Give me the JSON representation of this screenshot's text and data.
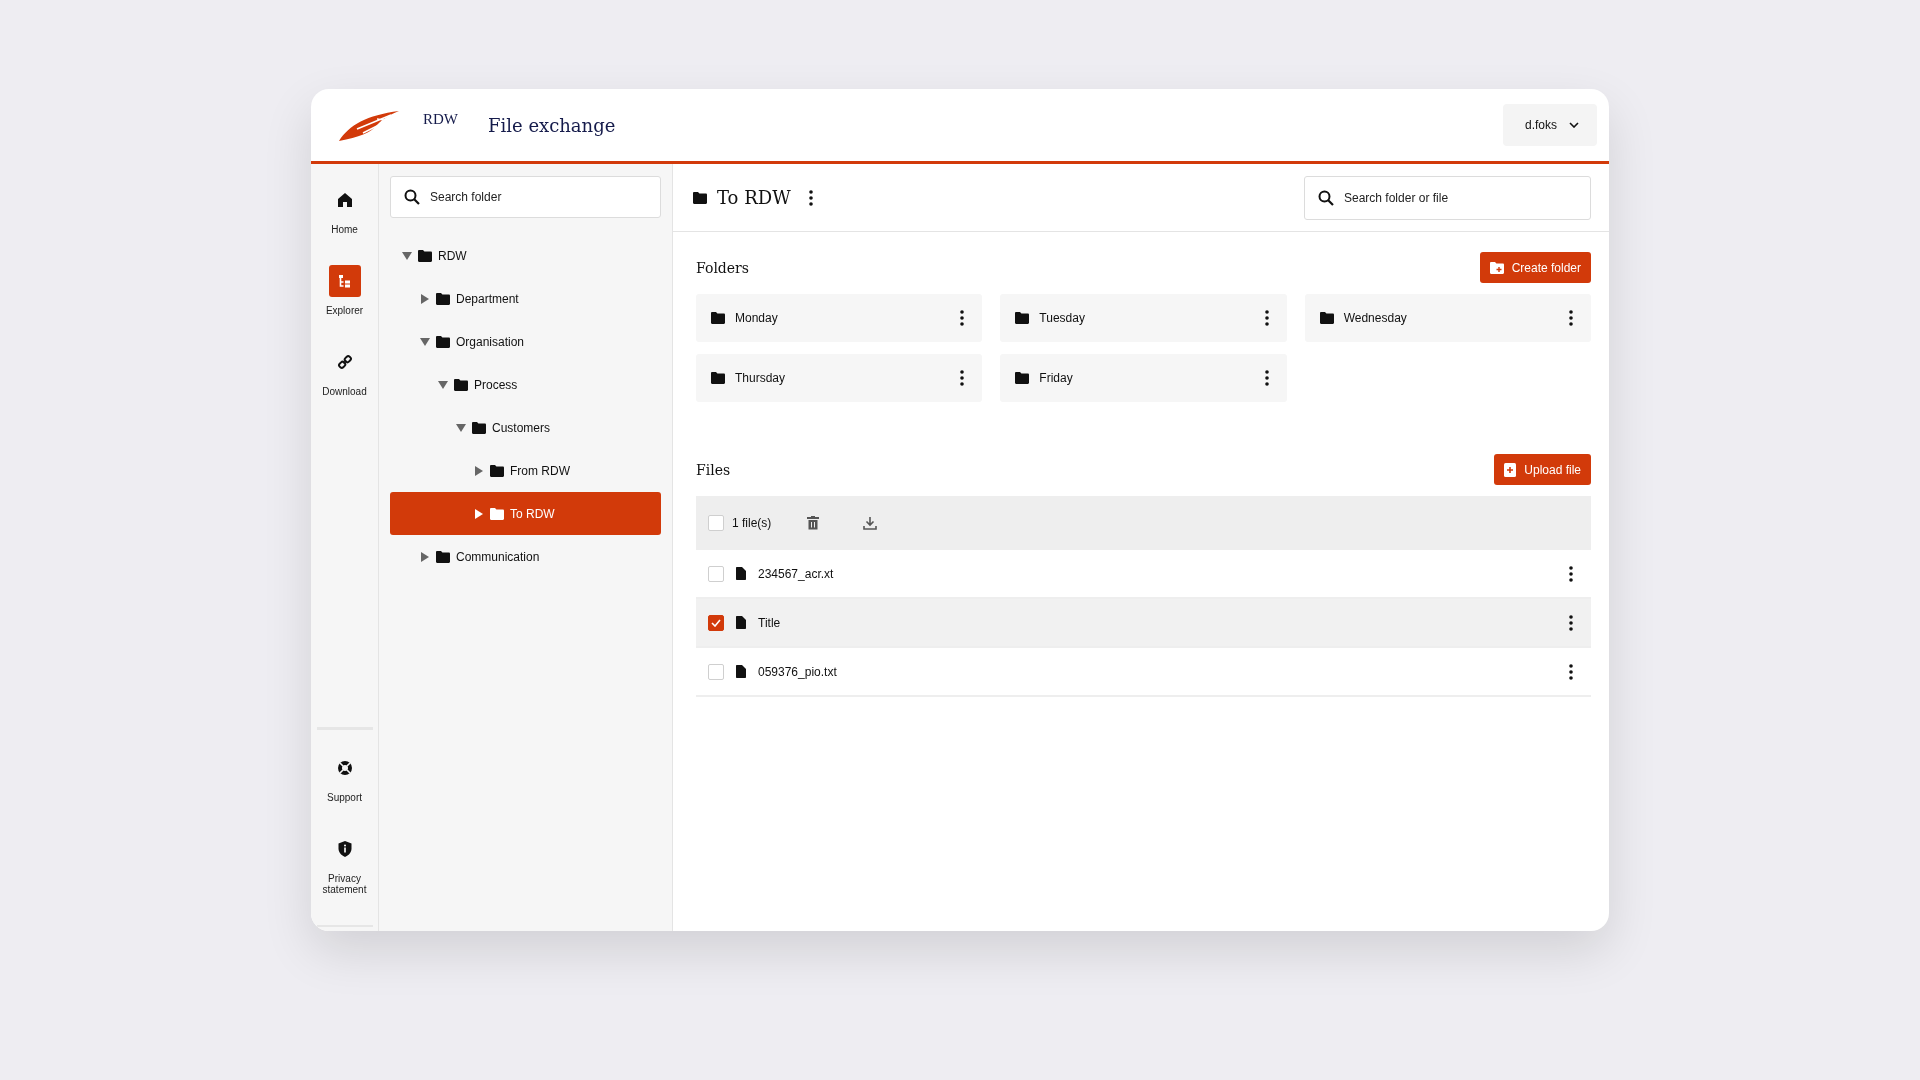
{
  "header": {
    "brand": "RDW",
    "title": "File exchange",
    "user": "d.foks"
  },
  "nav": {
    "top": [
      {
        "label": "Home",
        "kind": "home",
        "selected": false
      },
      {
        "label": "Explorer",
        "kind": "explorer",
        "selected": true
      },
      {
        "label": "Download",
        "kind": "download",
        "selected": false
      }
    ],
    "bottom": [
      {
        "label": "Support",
        "kind": "support",
        "selected": false
      },
      {
        "label": "Privacy statement",
        "kind": "privacy",
        "selected": false
      }
    ]
  },
  "tree": {
    "search": {
      "placeholder": "Search folder"
    },
    "items": [
      {
        "label": "RDW",
        "expanded": true,
        "selected": false,
        "children": [
          {
            "label": "Department",
            "expanded": false,
            "selected": false
          },
          {
            "label": "Organisation",
            "expanded": true,
            "selected": false,
            "children": [
              {
                "label": "Process",
                "expanded": true,
                "selected": false,
                "children": [
                  {
                    "label": "Customers",
                    "expanded": true,
                    "selected": false,
                    "children": [
                      {
                        "label": "From RDW",
                        "expanded": false,
                        "selected": false
                      },
                      {
                        "label": "To RDW",
                        "expanded": false,
                        "selected": true
                      }
                    ]
                  }
                ]
              }
            ]
          },
          {
            "label": "Communication",
            "expanded": false,
            "selected": false
          }
        ]
      }
    ]
  },
  "main": {
    "title": "To RDW",
    "search": {
      "placeholder": "Search folder or file"
    },
    "folders": {
      "heading": "Folders",
      "button": "Create folder",
      "items": [
        "Monday",
        "Tuesday",
        "Wednesday",
        "Thursday",
        "Friday"
      ]
    },
    "files": {
      "heading": "Files",
      "button": "Upload file",
      "toolbar": {
        "checked": false,
        "count": "1 file(s)"
      },
      "rows": [
        {
          "name": "234567_acr.xt",
          "checked": false
        },
        {
          "name": "Title",
          "checked": true
        },
        {
          "name": "059376_pio.txt",
          "checked": false
        }
      ]
    }
  }
}
